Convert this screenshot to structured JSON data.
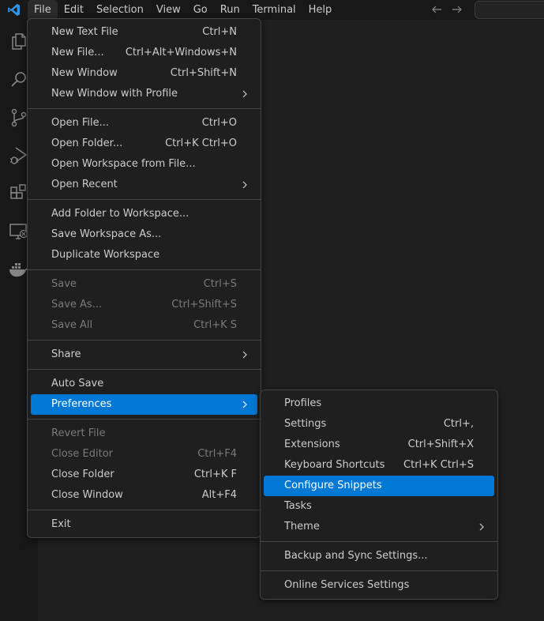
{
  "menubar": {
    "items": [
      "File",
      "Edit",
      "Selection",
      "View",
      "Go",
      "Run",
      "Terminal",
      "Help"
    ]
  },
  "file_menu": {
    "groups": [
      [
        {
          "label": "New Text File",
          "shortcut": "Ctrl+N"
        },
        {
          "label": "New File...",
          "shortcut": "Ctrl+Alt+Windows+N"
        },
        {
          "label": "New Window",
          "shortcut": "Ctrl+Shift+N"
        },
        {
          "label": "New Window with Profile",
          "submenu": true
        }
      ],
      [
        {
          "label": "Open File...",
          "shortcut": "Ctrl+O"
        },
        {
          "label": "Open Folder...",
          "shortcut": "Ctrl+K Ctrl+O"
        },
        {
          "label": "Open Workspace from File..."
        },
        {
          "label": "Open Recent",
          "submenu": true
        }
      ],
      [
        {
          "label": "Add Folder to Workspace..."
        },
        {
          "label": "Save Workspace As..."
        },
        {
          "label": "Duplicate Workspace"
        }
      ],
      [
        {
          "label": "Save",
          "shortcut": "Ctrl+S",
          "disabled": true
        },
        {
          "label": "Save As...",
          "shortcut": "Ctrl+Shift+S",
          "disabled": true
        },
        {
          "label": "Save All",
          "shortcut": "Ctrl+K S",
          "disabled": true
        }
      ],
      [
        {
          "label": "Share",
          "submenu": true
        }
      ],
      [
        {
          "label": "Auto Save"
        },
        {
          "label": "Preferences",
          "submenu": true,
          "selected": true
        }
      ],
      [
        {
          "label": "Revert File",
          "disabled": true
        },
        {
          "label": "Close Editor",
          "shortcut": "Ctrl+F4",
          "disabled": true
        },
        {
          "label": "Close Folder",
          "shortcut": "Ctrl+K F"
        },
        {
          "label": "Close Window",
          "shortcut": "Alt+F4"
        }
      ],
      [
        {
          "label": "Exit"
        }
      ]
    ]
  },
  "preferences_menu": {
    "groups": [
      [
        {
          "label": "Profiles"
        },
        {
          "label": "Settings",
          "shortcut": "Ctrl+,"
        },
        {
          "label": "Extensions",
          "shortcut": "Ctrl+Shift+X"
        },
        {
          "label": "Keyboard Shortcuts",
          "shortcut": "Ctrl+K Ctrl+S"
        },
        {
          "label": "Configure Snippets",
          "selected": true
        },
        {
          "label": "Tasks"
        },
        {
          "label": "Theme",
          "submenu": true
        }
      ],
      [
        {
          "label": "Backup and Sync Settings..."
        }
      ],
      [
        {
          "label": "Online Services Settings"
        }
      ]
    ]
  },
  "colors": {
    "accent": "#0078d4",
    "titlebar": "#181818",
    "editor": "#1f1f1f",
    "menu_text": "#cccccc",
    "disabled_text": "#7a7a7a"
  },
  "icons": {
    "app_logo": "vscode-logo-icon",
    "activity_bar": [
      "explorer-icon",
      "search-icon",
      "source-control-icon",
      "run-debug-icon",
      "extensions-icon",
      "remote-explorer-icon",
      "docker-icon"
    ],
    "navigation": [
      "back-arrow-icon",
      "forward-arrow-icon"
    ],
    "submenu": "chevron-right-icon"
  }
}
